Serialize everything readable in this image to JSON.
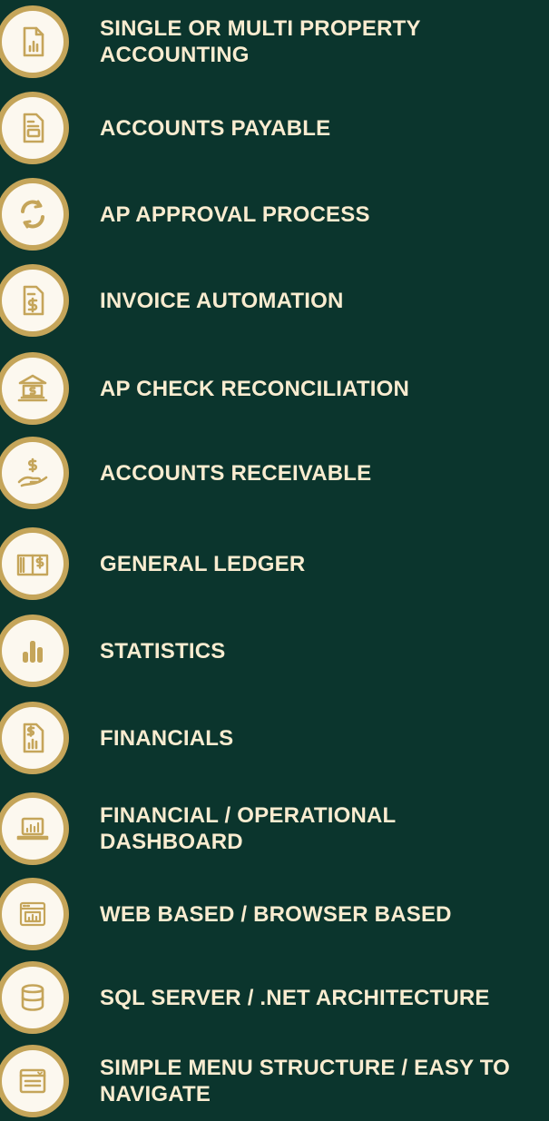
{
  "colors": {
    "background": "#0b352d",
    "badge_ring": "#c5a55a",
    "badge_fill": "#fcf8ef",
    "icon": "#c5a55a",
    "text": "#f9ecd0"
  },
  "features": [
    {
      "icon": "document-chart-icon",
      "label": "SINGLE OR MULTI PROPERTY ACCOUNTING"
    },
    {
      "icon": "invoice-document-icon",
      "label": "ACCOUNTS PAYABLE"
    },
    {
      "icon": "refresh-cycle-icon",
      "label": "AP APPROVAL PROCESS"
    },
    {
      "icon": "dollar-document-icon",
      "label": "INVOICE AUTOMATION"
    },
    {
      "icon": "bank-icon",
      "label": "AP CHECK RECONCILIATION"
    },
    {
      "icon": "hand-money-icon",
      "label": "ACCOUNTS RECEIVABLE"
    },
    {
      "icon": "ledger-book-icon",
      "label": "GENERAL LEDGER"
    },
    {
      "icon": "bar-chart-icon",
      "label": "STATISTICS"
    },
    {
      "icon": "financial-report-icon",
      "label": "FINANCIALS"
    },
    {
      "icon": "laptop-chart-icon",
      "label": "FINANCIAL / OPERATIONAL DASHBOARD"
    },
    {
      "icon": "browser-window-icon",
      "label": "WEB BASED / BROWSER BASED"
    },
    {
      "icon": "database-icon",
      "label": "SQL SERVER / .NET ARCHITECTURE"
    },
    {
      "icon": "menu-window-icon",
      "label": "SIMPLE MENU STRUCTURE / EASY TO NAVIGATE"
    }
  ]
}
